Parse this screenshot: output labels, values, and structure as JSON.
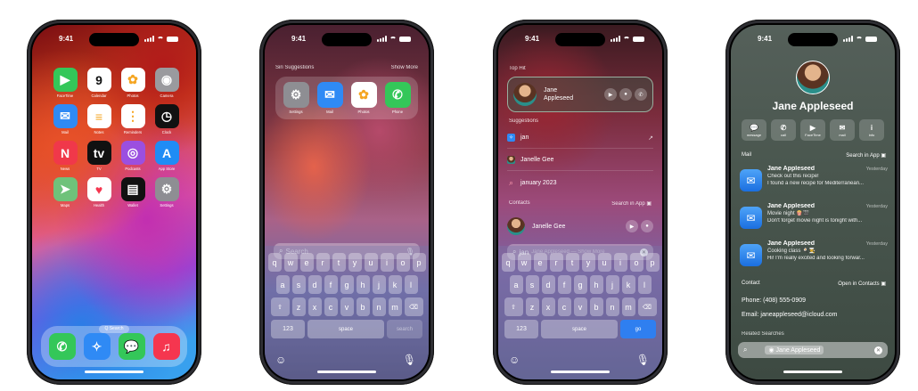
{
  "status_time": "9:41",
  "phone1": {
    "apps": [
      {
        "label": "FaceTime",
        "icon": "facetime-icon",
        "color": "#34c759",
        "glyph": "▶"
      },
      {
        "label": "Calendar",
        "icon": "calendar-icon",
        "color": "#ffffff",
        "glyph": "9"
      },
      {
        "label": "Photos",
        "icon": "photos-icon",
        "color": "#ffffff",
        "glyph": "✿"
      },
      {
        "label": "Camera",
        "icon": "camera-icon",
        "color": "#9a9a9e",
        "glyph": "◉"
      },
      {
        "label": "Mail",
        "icon": "mail-icon",
        "color": "#2f8af5",
        "glyph": "✉"
      },
      {
        "label": "Notes",
        "icon": "notes-icon",
        "color": "#ffffff",
        "glyph": "≡"
      },
      {
        "label": "Reminders",
        "icon": "reminders-icon",
        "color": "#ffffff",
        "glyph": "⋮"
      },
      {
        "label": "Clock",
        "icon": "clock-icon",
        "color": "#111111",
        "glyph": "◷"
      },
      {
        "label": "News",
        "icon": "news-icon",
        "color": "#f0384a",
        "glyph": "N"
      },
      {
        "label": "TV",
        "icon": "tv-icon",
        "color": "#111111",
        "glyph": "tv"
      },
      {
        "label": "Podcasts",
        "icon": "podcasts-icon",
        "color": "#9b4fe0",
        "glyph": "◎"
      },
      {
        "label": "App Store",
        "icon": "appstore-icon",
        "color": "#1f8cf5",
        "glyph": "A"
      },
      {
        "label": "Maps",
        "icon": "maps-icon",
        "color": "#6fc27a",
        "glyph": "➤"
      },
      {
        "label": "Health",
        "icon": "health-icon",
        "color": "#ffffff",
        "glyph": "♥"
      },
      {
        "label": "Wallet",
        "icon": "wallet-icon",
        "color": "#111111",
        "glyph": "▤"
      },
      {
        "label": "Settings",
        "icon": "settings-icon",
        "color": "#8e8e93",
        "glyph": "⚙"
      }
    ],
    "search_pill": "Q Search",
    "dock": [
      {
        "icon": "phone-icon",
        "color": "#34c759",
        "glyph": "✆"
      },
      {
        "icon": "safari-icon",
        "color": "#2f8af5",
        "glyph": "✧"
      },
      {
        "icon": "messages-icon",
        "color": "#34c759",
        "glyph": "💬"
      },
      {
        "icon": "music-icon",
        "color": "#f5364f",
        "glyph": "♫"
      }
    ]
  },
  "phone2": {
    "suggestions_header": "Siri Suggestions",
    "show_more": "Show More",
    "suggestions": [
      {
        "label": "Settings",
        "icon": "settings-icon",
        "color": "#8e8e93",
        "glyph": "⚙"
      },
      {
        "label": "Mail",
        "icon": "mail-icon",
        "color": "#2f8af5",
        "glyph": "✉"
      },
      {
        "label": "Photos",
        "icon": "photos-icon",
        "color": "#ffffff",
        "glyph": "✿"
      },
      {
        "label": "Phone",
        "icon": "phone-icon",
        "color": "#34c759",
        "glyph": "✆"
      }
    ],
    "search_placeholder": "Search",
    "keyboard": {
      "row1": [
        "q",
        "w",
        "e",
        "r",
        "t",
        "y",
        "u",
        "i",
        "o",
        "p"
      ],
      "row2": [
        "a",
        "s",
        "d",
        "f",
        "g",
        "h",
        "j",
        "k",
        "l"
      ],
      "row3": [
        "z",
        "x",
        "c",
        "v",
        "b",
        "n",
        "m"
      ],
      "numbers_key": "123",
      "space_key": "space",
      "action_key": "search"
    }
  },
  "phone3": {
    "top_hit_header": "Top Hit",
    "top_hit_name": "Jane Appleseed",
    "suggestions_header": "Suggestions",
    "suggestions": [
      "jan",
      "Janelle Gee",
      "january 2023"
    ],
    "contacts_header": "Contacts",
    "search_in_app": "Search in App",
    "contact_name": "Janelle Gee",
    "search_text": "jan",
    "search_hint": "Jane Appleseed — Show More",
    "action_key": "go"
  },
  "phone4": {
    "contact_name": "Jane Appleseed",
    "actions": [
      {
        "label": "message",
        "icon": "message-icon",
        "glyph": "💬"
      },
      {
        "label": "call",
        "icon": "call-icon",
        "glyph": "✆"
      },
      {
        "label": "FaceTime",
        "icon": "facetime-icon",
        "glyph": "▶"
      },
      {
        "label": "mail",
        "icon": "mail-icon",
        "glyph": "✉"
      },
      {
        "label": "info",
        "icon": "info-icon",
        "glyph": "i"
      }
    ],
    "mail_header": "Mail",
    "search_in_app": "Search in App",
    "mails": [
      {
        "from": "Jane Appleseed",
        "date": "Yesterday",
        "subject": "Check out this recipe!",
        "preview": "I found a new recipe for Mediterranean..."
      },
      {
        "from": "Jane Appleseed",
        "date": "Yesterday",
        "subject": "Movie night 🍿🎬",
        "preview": "Don't forget movie night is tonight with..."
      },
      {
        "from": "Jane Appleseed",
        "date": "Yesterday",
        "subject": "Cooking class 🍳🧑‍🍳",
        "preview": "Hi! I'm really excited and looking forwar..."
      }
    ],
    "contact_header": "Contact",
    "open_in_contacts": "Open in Contacts",
    "phone_line": "Phone: (408) 555-0909",
    "email_line": "Email: janeappleseed@icloud.com",
    "related_header": "Related Searches",
    "search_token": "Jane Appleseed"
  }
}
